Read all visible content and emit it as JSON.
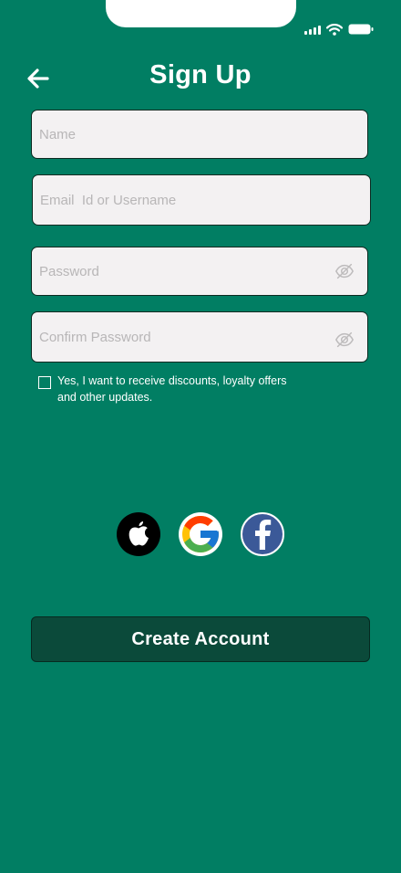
{
  "header": {
    "title": "Sign Up",
    "back_icon": "arrow-left-icon"
  },
  "form": {
    "name": {
      "placeholder": "Name",
      "value": ""
    },
    "email": {
      "placeholder": "Email  Id or Username",
      "value": ""
    },
    "password": {
      "placeholder": "Password",
      "value": "",
      "icon": "eye-off-icon"
    },
    "confirm_password": {
      "placeholder": "Confirm Password",
      "value": "",
      "icon": "eye-off-icon"
    },
    "consent": {
      "checked": false,
      "label": "Yes, I want to receive discounts, loyalty offers and other updates."
    }
  },
  "social": [
    {
      "name": "apple",
      "icon": "apple-icon"
    },
    {
      "name": "google",
      "icon": "google-icon"
    },
    {
      "name": "facebook",
      "icon": "facebook-icon"
    }
  ],
  "cta": {
    "label": "Create Account"
  },
  "colors": {
    "background": "#017E63",
    "button": "#0B4A3A",
    "field": "#F3F1F2"
  }
}
